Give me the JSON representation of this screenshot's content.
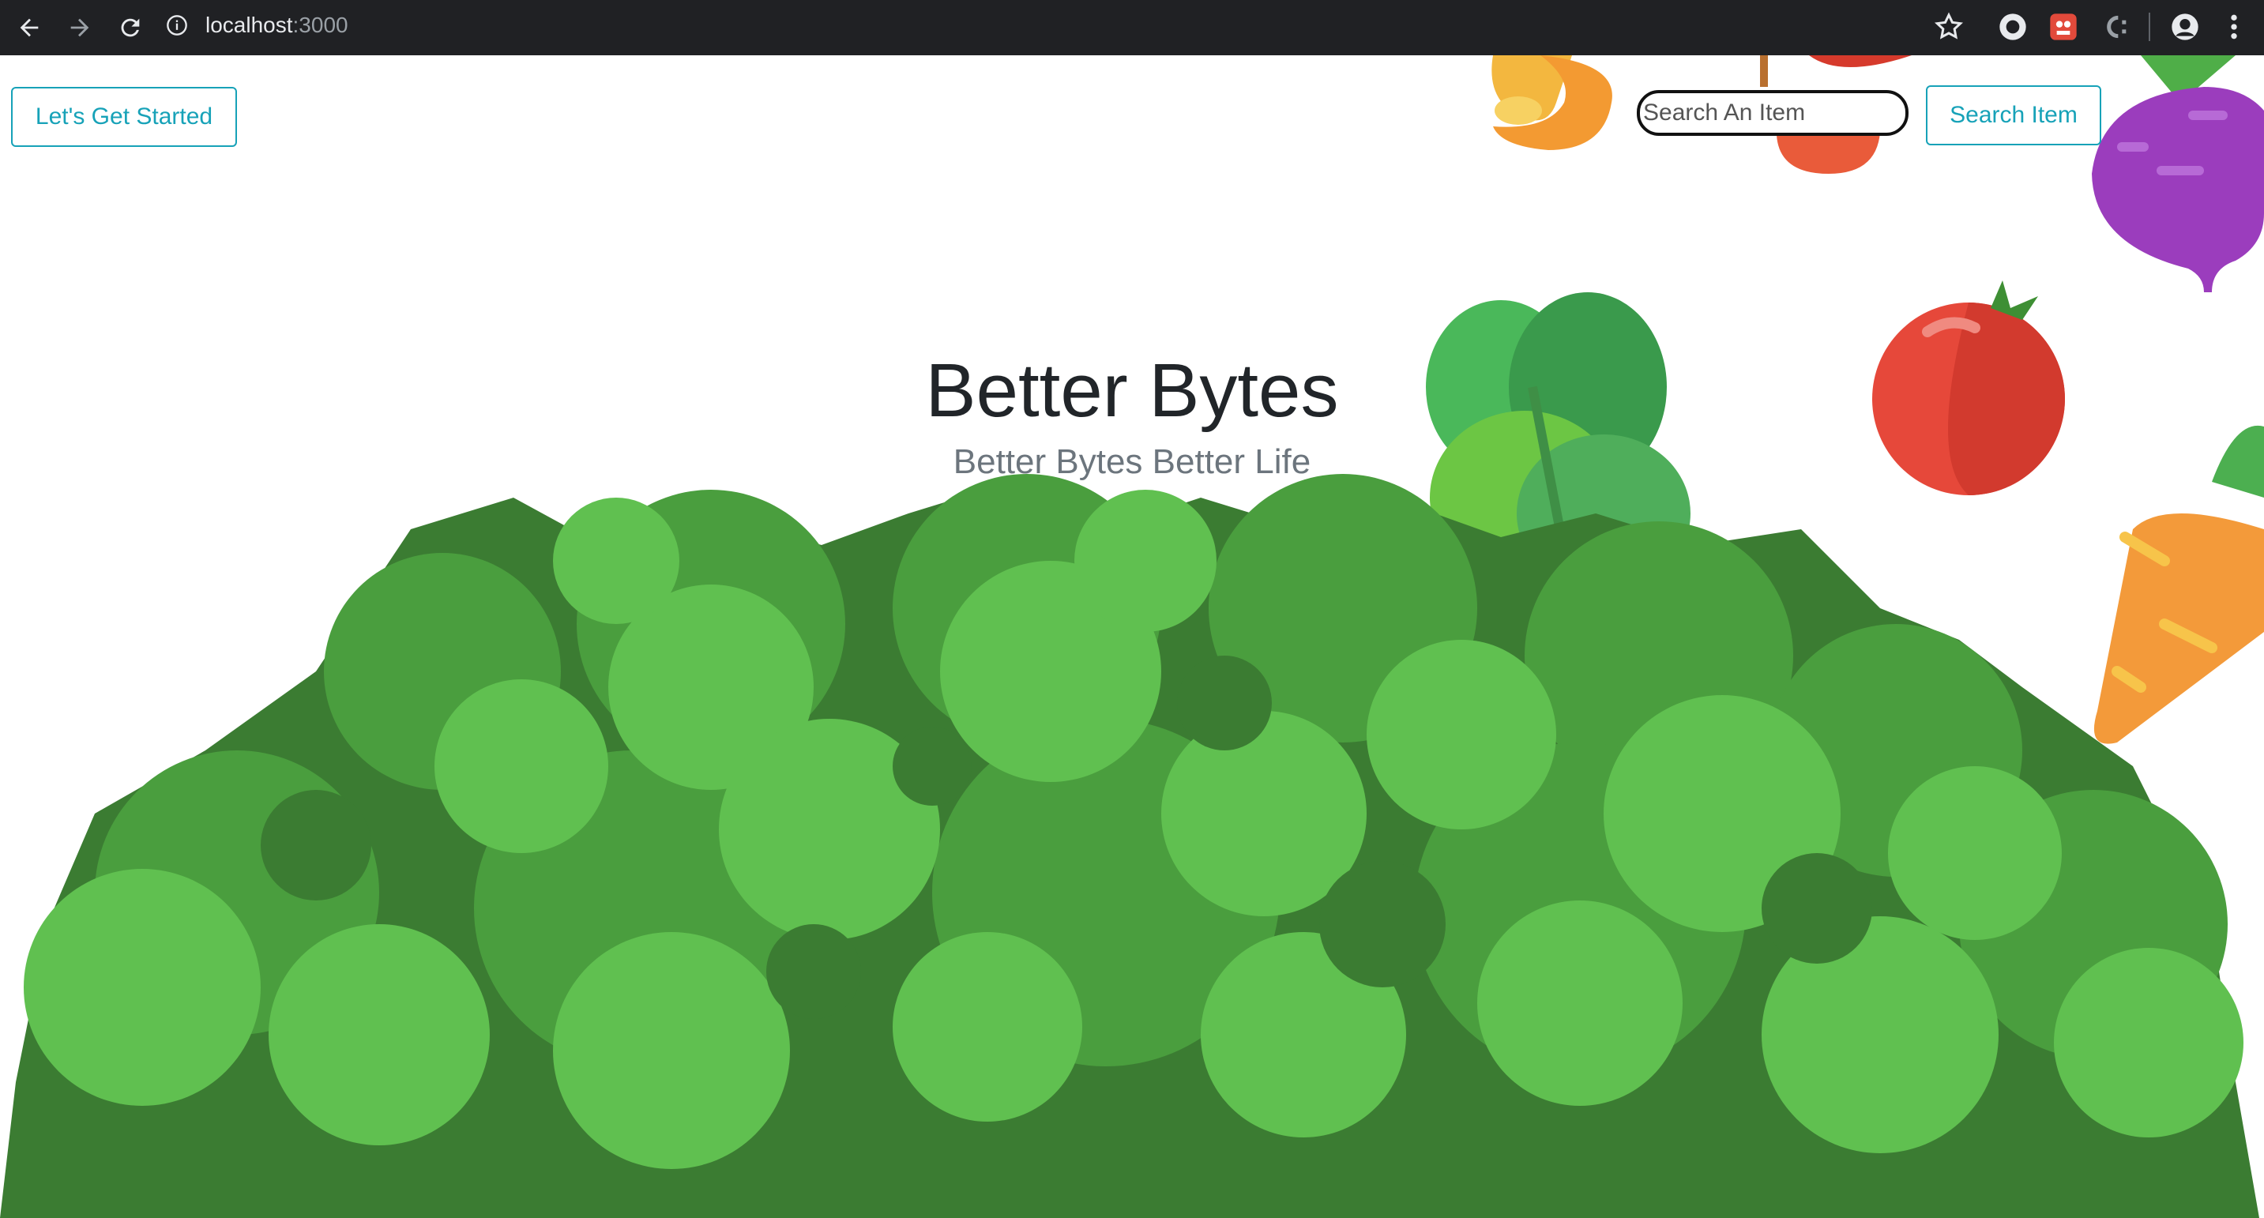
{
  "browser": {
    "url_host": "localhost",
    "url_port": ":3000"
  },
  "header": {
    "get_started_label": "Let's Get Started",
    "search_placeholder": "Search An Item",
    "search_button_label": "Search Item"
  },
  "hero": {
    "title": "Better Bytes",
    "subtitle": "Better Bytes Better Life"
  },
  "colors": {
    "accent": "#17a2b8",
    "title": "#212529",
    "subtitle": "#6c757d",
    "leaf_light": "#60c050",
    "leaf_mid": "#4a9e3e",
    "leaf_dark": "#3b7c32"
  }
}
